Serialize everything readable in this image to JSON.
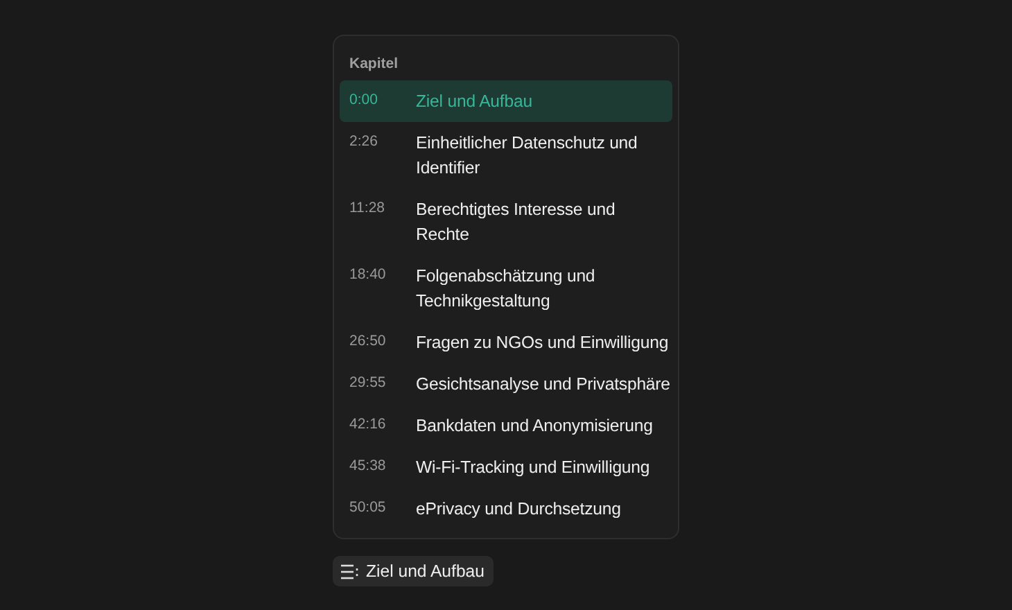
{
  "panel": {
    "title": "Kapitel",
    "chapters": [
      {
        "time": "0:00",
        "title": "Ziel und Aufbau",
        "selected": true
      },
      {
        "time": "2:26",
        "title": "Einheitlicher Datenschutz und Identifier",
        "selected": false
      },
      {
        "time": "11:28",
        "title": "Berechtigtes Interesse und Rechte",
        "selected": false
      },
      {
        "time": "18:40",
        "title": "Folgenabschätzung und Technikgestaltung",
        "selected": false
      },
      {
        "time": "26:50",
        "title": "Fragen zu NGOs und Einwilligung",
        "selected": false
      },
      {
        "time": "29:55",
        "title": "Gesichtsanalyse und Privatsphäre",
        "selected": false
      },
      {
        "time": "42:16",
        "title": "Bankdaten und Anonymisierung",
        "selected": false
      },
      {
        "time": "45:38",
        "title": "Wi-Fi-Tracking und Einwilligung",
        "selected": false
      },
      {
        "time": "50:05",
        "title": "ePrivacy und Durchsetzung",
        "selected": false
      }
    ]
  },
  "chapter_button": {
    "label": "Ziel und Aufbau"
  }
}
